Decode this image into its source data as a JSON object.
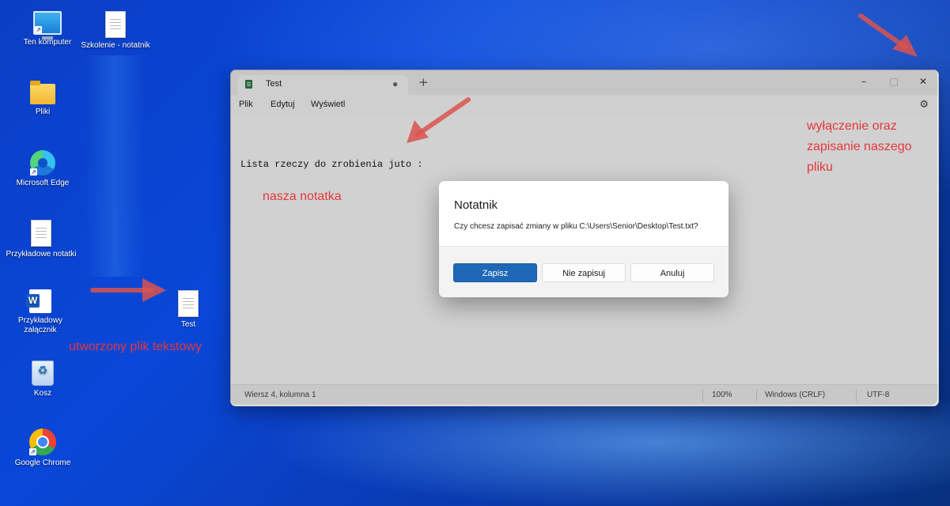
{
  "desktop": {
    "icons": [
      {
        "label": "Ten komputer",
        "icon": "computer-icon"
      },
      {
        "label": "Szkolenie - notatnik",
        "icon": "text-file-icon"
      },
      {
        "label": "Pliki",
        "icon": "folder-icon"
      },
      {
        "label": "Microsoft Edge",
        "icon": "edge-icon"
      },
      {
        "label": "Przykładowe notatki",
        "icon": "text-file-icon"
      },
      {
        "label": "Przykładowy załącznik",
        "icon": "word-document-icon"
      },
      {
        "label": "Test",
        "icon": "text-file-icon"
      },
      {
        "label": "Kosz",
        "icon": "recycle-bin-icon"
      },
      {
        "label": "Google Chrome",
        "icon": "chrome-icon"
      }
    ]
  },
  "annotations": {
    "created_file": "utworzony plik tekstowy",
    "our_note": "nasza notatka",
    "close_save_line1": "wyłączenie oraz",
    "close_save_line2": "zapisanie naszego",
    "close_save_line3": "pliku",
    "color": "#e5383b"
  },
  "notepad": {
    "tab_title": "Test",
    "tab_modified_marker": "●",
    "new_tab": "+",
    "controls": {
      "minimize": "–",
      "maximize": "□",
      "close": "✕"
    },
    "menu": {
      "file": "Plik",
      "edit": "Edytuj",
      "view": "Wyświetl"
    },
    "settings_icon": "⚙",
    "content": "Lista rzeczy do zrobienia juto :",
    "status": {
      "position": "Wiersz 4, kolumna 1",
      "zoom": "100%",
      "line_ending": "Windows (CRLF)",
      "encoding": "UTF-8"
    }
  },
  "dialog": {
    "title": "Notatnik",
    "message": "Czy chcesz zapisać zmiany w pliku C:\\Users\\Senior\\Desktop\\Test.txt?",
    "buttons": {
      "save": "Zapisz",
      "dont_save": "Nie zapisuj",
      "cancel": "Anuluj"
    },
    "accent": "#1f67b7"
  }
}
